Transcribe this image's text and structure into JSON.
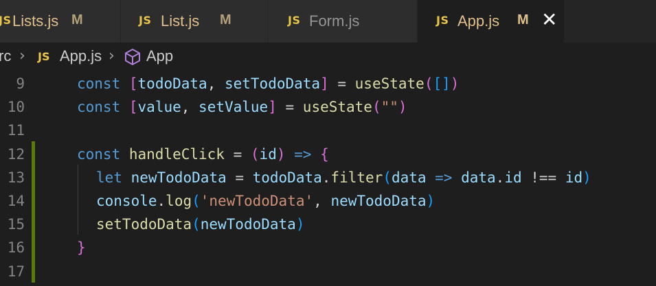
{
  "tabs": [
    {
      "icon": "JS",
      "label": "Lists.js",
      "badge": "M",
      "active": false
    },
    {
      "icon": "JS",
      "label": "List.js",
      "badge": "M",
      "active": false
    },
    {
      "icon": "JS",
      "label": "Form.js",
      "badge": "",
      "active": false
    },
    {
      "icon": "JS",
      "label": "App.js",
      "badge": "M",
      "active": true,
      "close": "✕"
    }
  ],
  "breadcrumb": {
    "folder": "rc",
    "sep": "›",
    "file_icon": "JS",
    "file": "App.js",
    "symbol_icon": "cube-icon",
    "symbol": "App"
  },
  "editor": {
    "line_numbers": [
      "9",
      "10",
      "11",
      "12",
      "13",
      "14",
      "15",
      "16",
      "17"
    ],
    "lines": [
      [
        "const",
        " ",
        "[",
        "todoData",
        ", ",
        "setTodoData",
        "]",
        " = ",
        "useState",
        "(",
        "[]",
        ")"
      ],
      [
        "const",
        " ",
        "[",
        "value",
        ", ",
        "setValue",
        "]",
        " = ",
        "useState",
        "(",
        "\"\"",
        ")"
      ],
      [],
      [
        "const",
        " ",
        "handleClick",
        " = ",
        "(",
        "id",
        ")",
        " => ",
        "{"
      ],
      [
        "let",
        " ",
        "newTodoData",
        " = ",
        "todoData",
        ".",
        "filter",
        "(",
        "data",
        " => ",
        "data",
        ".",
        "id",
        " !== ",
        "id",
        ")"
      ],
      [
        "console",
        ".",
        "log",
        "(",
        "'newTodoData'",
        ", ",
        "newTodoData",
        ")"
      ],
      [
        "setTodoData",
        "(",
        "newTodoData",
        ")"
      ],
      [
        "}"
      ],
      []
    ]
  },
  "colors": {
    "background": "#1e1e1e",
    "keyword": "#569cd6",
    "variable": "#9cdcfe",
    "function": "#dcdcaa",
    "string": "#ce9178",
    "bracket_1": "#ffd700",
    "bracket_2": "#da70d6",
    "bracket_3": "#179fff",
    "git_modified": "#587c0c"
  }
}
